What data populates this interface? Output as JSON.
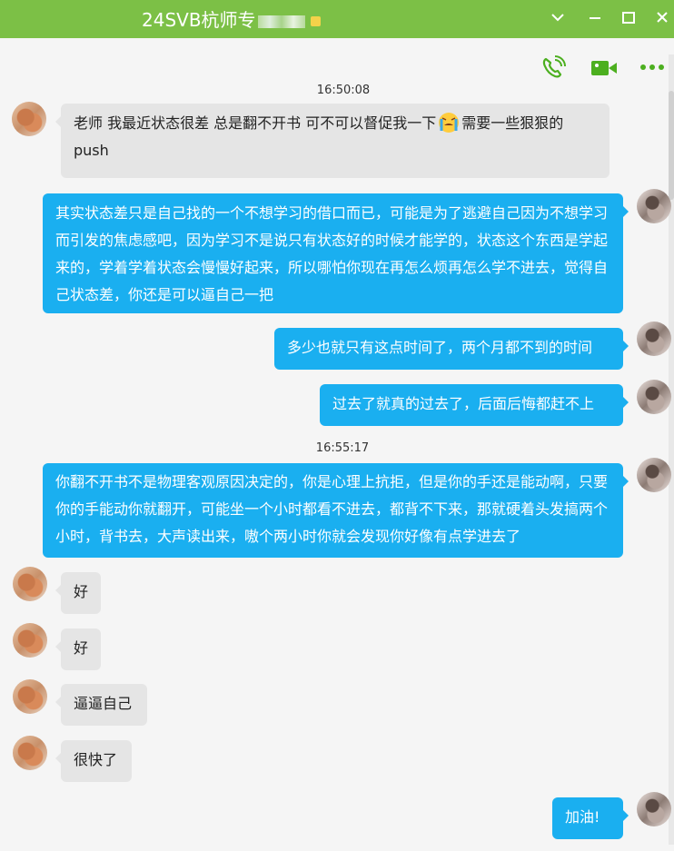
{
  "window": {
    "title": "24SVB杭师专",
    "buttons": [
      "minimize-chevron",
      "minimize",
      "maximize",
      "close"
    ]
  },
  "toolbar": {
    "icons": [
      "phone-icon",
      "video-icon",
      "more-icon"
    ]
  },
  "messages": [
    {
      "type": "time",
      "text": "16:50:08"
    },
    {
      "side": "left",
      "text_before": "老师 我最近状态很差 总是翻不开书 可不可以督促我一下",
      "emoji": "crying-face",
      "text_after": "需要一些狠狠的push"
    },
    {
      "side": "right",
      "text": "其实状态差只是自己找的一个不想学习的借口而已，可能是为了逃避自己因为不想学习而引发的焦虑感吧，因为学习不是说只有状态好的时候才能学的，状态这个东西是学起来的，学着学着状态会慢慢好起来，所以哪怕你现在再怎么烦再怎么学不进去，觉得自己状态差，你还是可以逼自己一把"
    },
    {
      "side": "right",
      "text": "多少也就只有这点时间了，两个月都不到的时间"
    },
    {
      "side": "right",
      "text": "过去了就真的过去了，后面后悔都赶不上"
    },
    {
      "type": "time",
      "text": "16:55:17"
    },
    {
      "side": "right",
      "text": "你翻不开书不是物理客观原因决定的，你是心理上抗拒，但是你的手还是能动啊，只要你的手能动你就翻开，可能坐一个小时都看不进去，都背不下来，那就硬着头发搞两个小时，背书去，大声读出来，嗷个两小时你就会发现你好像有点学进去了"
    },
    {
      "side": "left",
      "text": "好"
    },
    {
      "side": "left",
      "text": "好"
    },
    {
      "side": "left",
      "text": "逼逼自己"
    },
    {
      "side": "left",
      "text": "很快了"
    },
    {
      "side": "right",
      "text": "加油!"
    }
  ],
  "colors": {
    "titlebar": "#7cc046",
    "outgoing_bubble": "#1aaff0",
    "incoming_bubble": "#e5e5e5",
    "toolbar_icon": "#4caf1f"
  }
}
